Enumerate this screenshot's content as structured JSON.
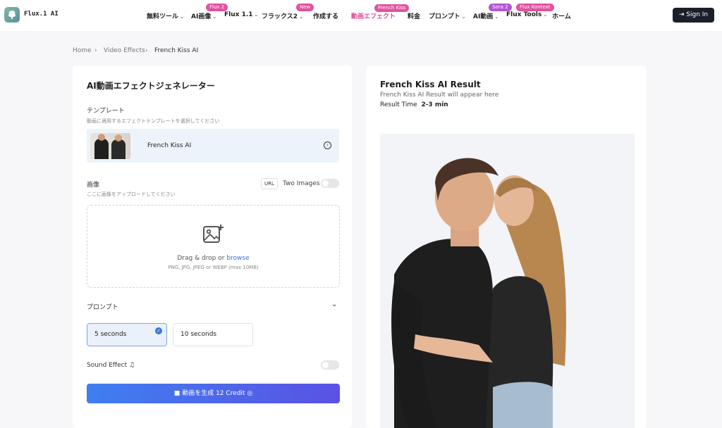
{
  "header": {
    "brand": "Flux.1 AI",
    "nav": [
      {
        "label": "無料ツール",
        "chevron": true,
        "badge": ""
      },
      {
        "label": "AI画像",
        "chevron": true,
        "badge": "Flux 2"
      },
      {
        "label": "Flux 1.1",
        "chevron": true,
        "badge": ""
      },
      {
        "label": "フラックス2",
        "chevron": true,
        "badge": "New"
      },
      {
        "label": "作成する",
        "chevron": false,
        "badge": ""
      },
      {
        "label": "動画エフェクト",
        "chevron": false,
        "badge": "French Kiss"
      },
      {
        "label": "料金",
        "chevron": false,
        "badge": ""
      },
      {
        "label": "プロンプト",
        "chevron": true,
        "badge": ""
      },
      {
        "label": "AI動画",
        "chevron": true,
        "badge": "Sora 2"
      },
      {
        "label": "Flux Tools",
        "chevron": true,
        "badge": "Flux Kontext"
      },
      {
        "label": "ホーム",
        "chevron": false,
        "badge": ""
      }
    ],
    "signin_label": "Sign In"
  },
  "breadcrumb": [
    "Home",
    "Video Effects",
    "French Kiss AI"
  ],
  "generator": {
    "title": "AI動画エフェクトジェネレーター",
    "template_label": "テンプレート",
    "template_hint": "動画に適用するエフェクトテンプレートを選択してください",
    "template_name": "French Kiss AI",
    "image_label": "画像",
    "image_hint": "ここに画像をアップロードしてください",
    "url_label": "URL",
    "two_images_label": "Two Images",
    "drop_text": "Drag & drop or ",
    "browse_link": "browse",
    "formats": "PNG, JPG, JPEG or WEBP (max 10MB)",
    "prompt_label": "プロンプト",
    "durations": [
      "5 seconds",
      "10 seconds"
    ],
    "selected_duration": "5 seconds",
    "sound_effect_label": "Sound Effect",
    "generate_label": "動画を生成",
    "credit_label": "12 Credit"
  },
  "result": {
    "title": "French Kiss AI Result",
    "subtitle": "French Kiss AI Result will appear here",
    "time_label": "Result Time",
    "time_value": "2-3 min"
  },
  "colors": {
    "accent_pink": "#e2519f",
    "active_nav": "#e0489a",
    "button_start": "#3f7ff0",
    "button_end": "#5a52e4",
    "signin_bg": "#1b1e2b"
  }
}
